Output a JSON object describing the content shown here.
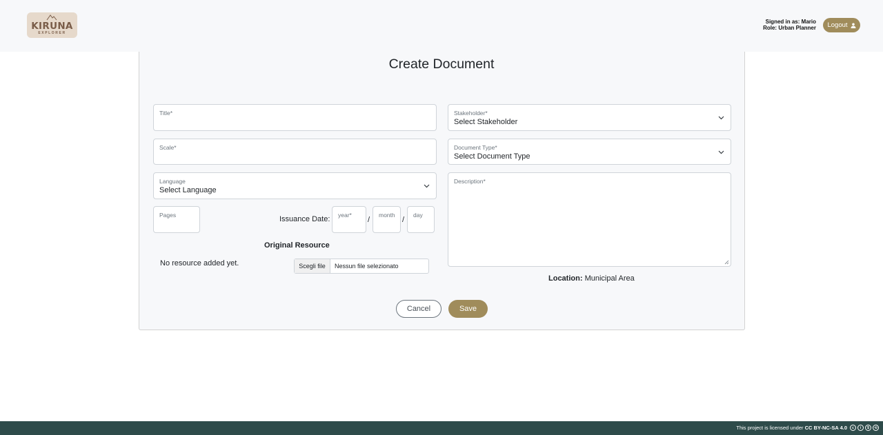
{
  "header": {
    "logo_name": "KIRUNA",
    "logo_sub": "EXPLORER",
    "signed_in_label": "Signed in as:",
    "signed_in_user": "Mario",
    "role_label": "Role:",
    "role_value": "Urban Planner",
    "logout_label": "Logout"
  },
  "form": {
    "title": "Create Document",
    "title_field": {
      "label": "Title*",
      "value": ""
    },
    "scale_field": {
      "label": "Scale*",
      "value": ""
    },
    "language_field": {
      "label": "Language",
      "value": "Select Language"
    },
    "pages_field": {
      "label": "Pages",
      "value": ""
    },
    "issuance_label": "Issuance Date:",
    "year_placeholder": "year*",
    "month_placeholder": "month",
    "day_placeholder": "day",
    "date_separator": "/",
    "stakeholder_field": {
      "label": "Stakeholder*",
      "value": "Select Stakeholder"
    },
    "doctype_field": {
      "label": "Document Type*",
      "value": "Select Document Type"
    },
    "description_field": {
      "label": "Description*",
      "value": ""
    },
    "original_resource_label": "Original Resource",
    "no_resource_text": "No resource added yet.",
    "file_button_label": "Scegli file",
    "file_name_text": "Nessun file selezionato",
    "location_label": "Location:",
    "location_value": "Municipal Area",
    "cancel_label": "Cancel",
    "save_label": "Save"
  },
  "footer": {
    "license_prefix": "This project is licensed under",
    "license_name": "CC BY-NC-SA 4.0"
  },
  "colors": {
    "accent": "#a08c5b",
    "footer_bg": "#2e4b4a",
    "logo_bg": "#e6d9cb"
  }
}
